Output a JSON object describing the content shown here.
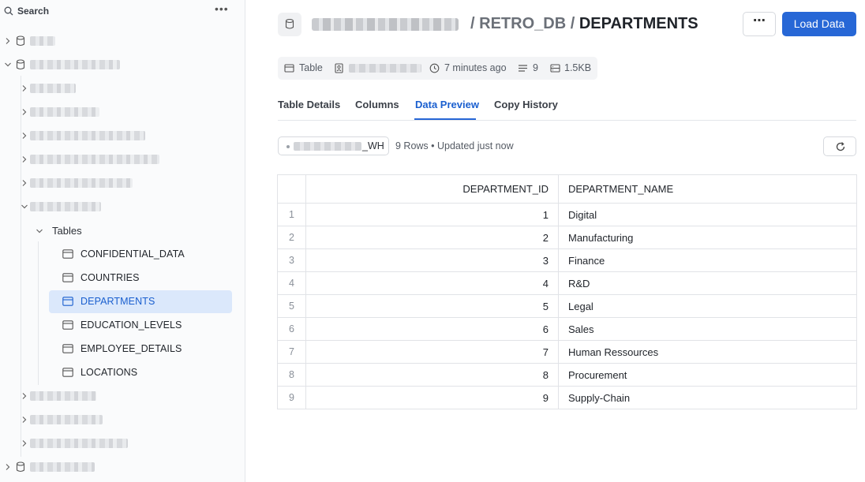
{
  "sidebar": {
    "search_label": "Search",
    "tables_label": "Tables",
    "tables": [
      {
        "label": "CONFIDENTIAL_DATA",
        "selected": false
      },
      {
        "label": "COUNTRIES",
        "selected": false
      },
      {
        "label": "DEPARTMENTS",
        "selected": true
      },
      {
        "label": "EDUCATION_LEVELS",
        "selected": false
      },
      {
        "label": "EMPLOYEE_DETAILS",
        "selected": false
      },
      {
        "label": "LOCATIONS",
        "selected": false
      }
    ]
  },
  "header": {
    "breadcrumb_separator": "/",
    "schema": "RETRO_DB",
    "table": "DEPARTMENTS",
    "more_label": "⋯",
    "load_button": "Load Data"
  },
  "meta": {
    "type": "Table",
    "updated": "7 minutes ago",
    "columns": "9",
    "size": "1.5KB"
  },
  "tabs": [
    {
      "label": "Table Details",
      "active": false
    },
    {
      "label": "Columns",
      "active": false
    },
    {
      "label": "Data Preview",
      "active": true
    },
    {
      "label": "Copy History",
      "active": false
    }
  ],
  "preview": {
    "warehouse_suffix": "_WH",
    "status": "9 Rows • Updated just now",
    "columns": [
      "DEPARTMENT_ID",
      "DEPARTMENT_NAME"
    ],
    "rows": [
      {
        "n": "1",
        "id": "1",
        "name": "Digital"
      },
      {
        "n": "2",
        "id": "2",
        "name": "Manufacturing"
      },
      {
        "n": "3",
        "id": "3",
        "name": "Finance"
      },
      {
        "n": "4",
        "id": "4",
        "name": "R&D"
      },
      {
        "n": "5",
        "id": "5",
        "name": "Legal"
      },
      {
        "n": "6",
        "id": "6",
        "name": "Sales"
      },
      {
        "n": "7",
        "id": "7",
        "name": "Human Ressources"
      },
      {
        "n": "8",
        "id": "8",
        "name": "Procurement"
      },
      {
        "n": "9",
        "id": "9",
        "name": "Supply-Chain"
      }
    ]
  },
  "colors": {
    "accent": "#2767d6",
    "selected_bg": "#dbe8fb"
  }
}
